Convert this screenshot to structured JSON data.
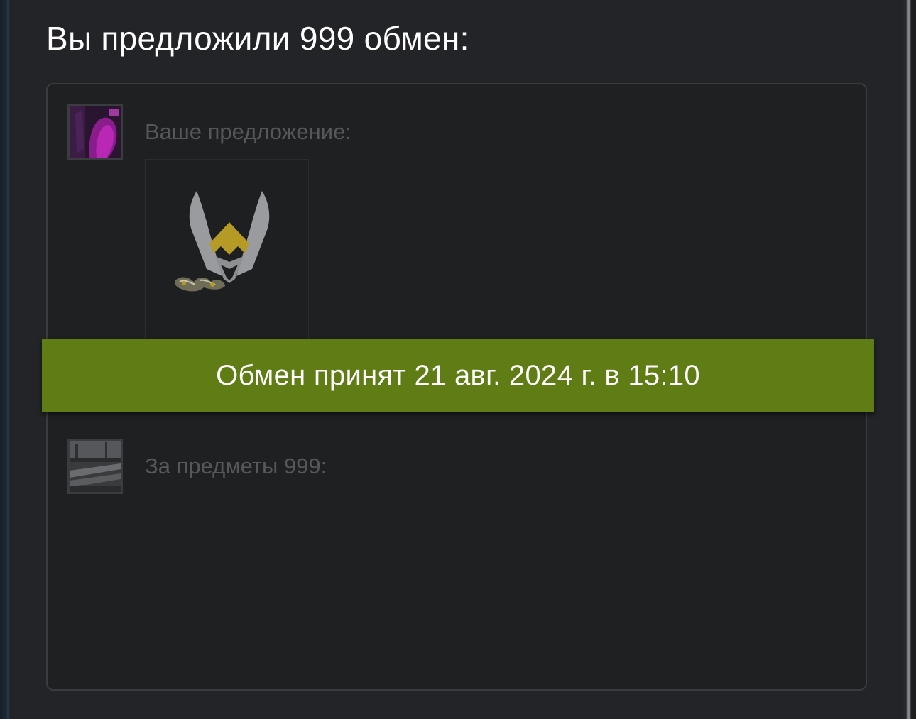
{
  "trade": {
    "heading": "Вы предложили 999 обмен:",
    "offer_label": "Ваше предложение:",
    "for_label": "За предметы 999:",
    "status": "Обмен принят 21 авг. 2024 г. в 15:10"
  },
  "colors": {
    "status_banner": "#5f7d14",
    "background": "#232427",
    "box_background": "#1f2022",
    "muted_text": "#55575a"
  }
}
